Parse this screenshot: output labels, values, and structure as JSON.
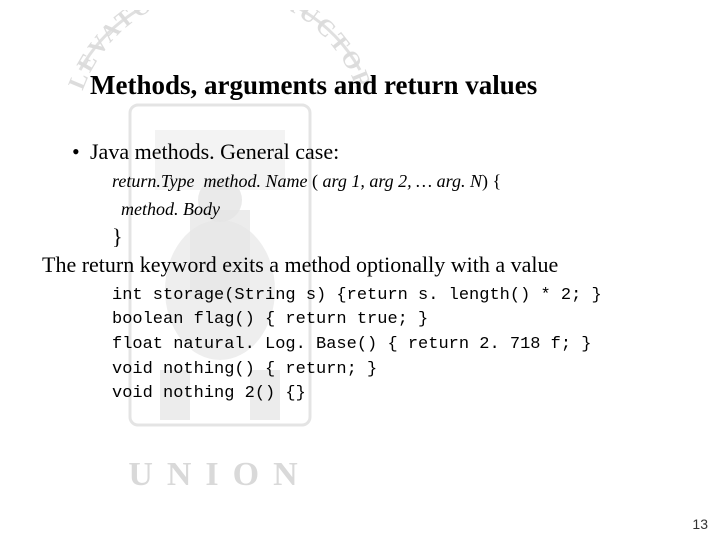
{
  "title": "Methods, arguments and return values",
  "bullet": "Java methods. General case:",
  "signature_line1": {
    "returnType": "return.Type",
    "methodName": "method. Name",
    "args": "arg 1, arg 2, … arg. N"
  },
  "signature_line2": "method. Body",
  "close_brace": "}",
  "explain": "The return keyword exits a method optionally with a value",
  "code": [
    "int storage(String s) {return s. length() * 2; }",
    "boolean flag() { return true; }",
    "float natural. Log. Base() { return 2. 718 f; }",
    "void nothing() { return; }",
    "void nothing 2() {}"
  ],
  "page_number": "13",
  "logo_text_top": "ELEVATOR CONSTRUCTORS",
  "logo_text_bottom": "UNION"
}
